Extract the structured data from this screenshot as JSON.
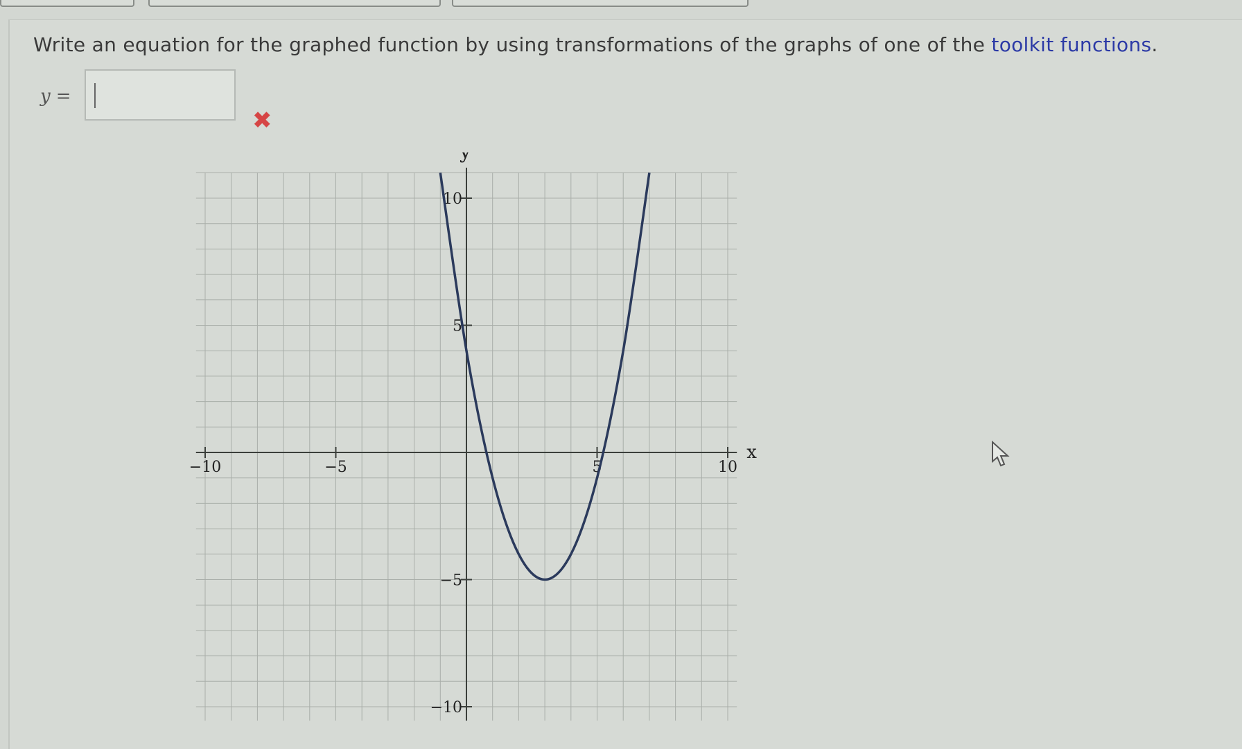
{
  "question": {
    "text": "Write an equation for the graphed function by using transformations of the graphs of one of the ",
    "link": "toolkit functions",
    "end": "."
  },
  "answer": {
    "label": "y",
    "equals": "=",
    "value": "",
    "feedback_icon": "x-mark-icon",
    "feedback_color": "#d64545"
  },
  "chart_data": {
    "type": "line",
    "xlabel": "x",
    "ylabel": "y",
    "xlim": [
      -10,
      10
    ],
    "ylim": [
      -10,
      10
    ],
    "grid": true,
    "x_ticks": [
      -10,
      -5,
      5,
      10
    ],
    "x_tick_labels": [
      "−10",
      "−5",
      "5",
      "10"
    ],
    "y_ticks": [
      10,
      5,
      -5,
      -10
    ],
    "y_tick_labels": [
      "10",
      "5",
      "−5",
      "−10"
    ],
    "series": [
      {
        "color": "#2b3a5c",
        "x": [
          -1,
          0,
          1,
          2,
          3,
          4,
          5,
          6,
          7
        ],
        "y": [
          11,
          4,
          -1,
          -4,
          -5,
          -4,
          -1,
          4,
          11
        ]
      }
    ]
  }
}
